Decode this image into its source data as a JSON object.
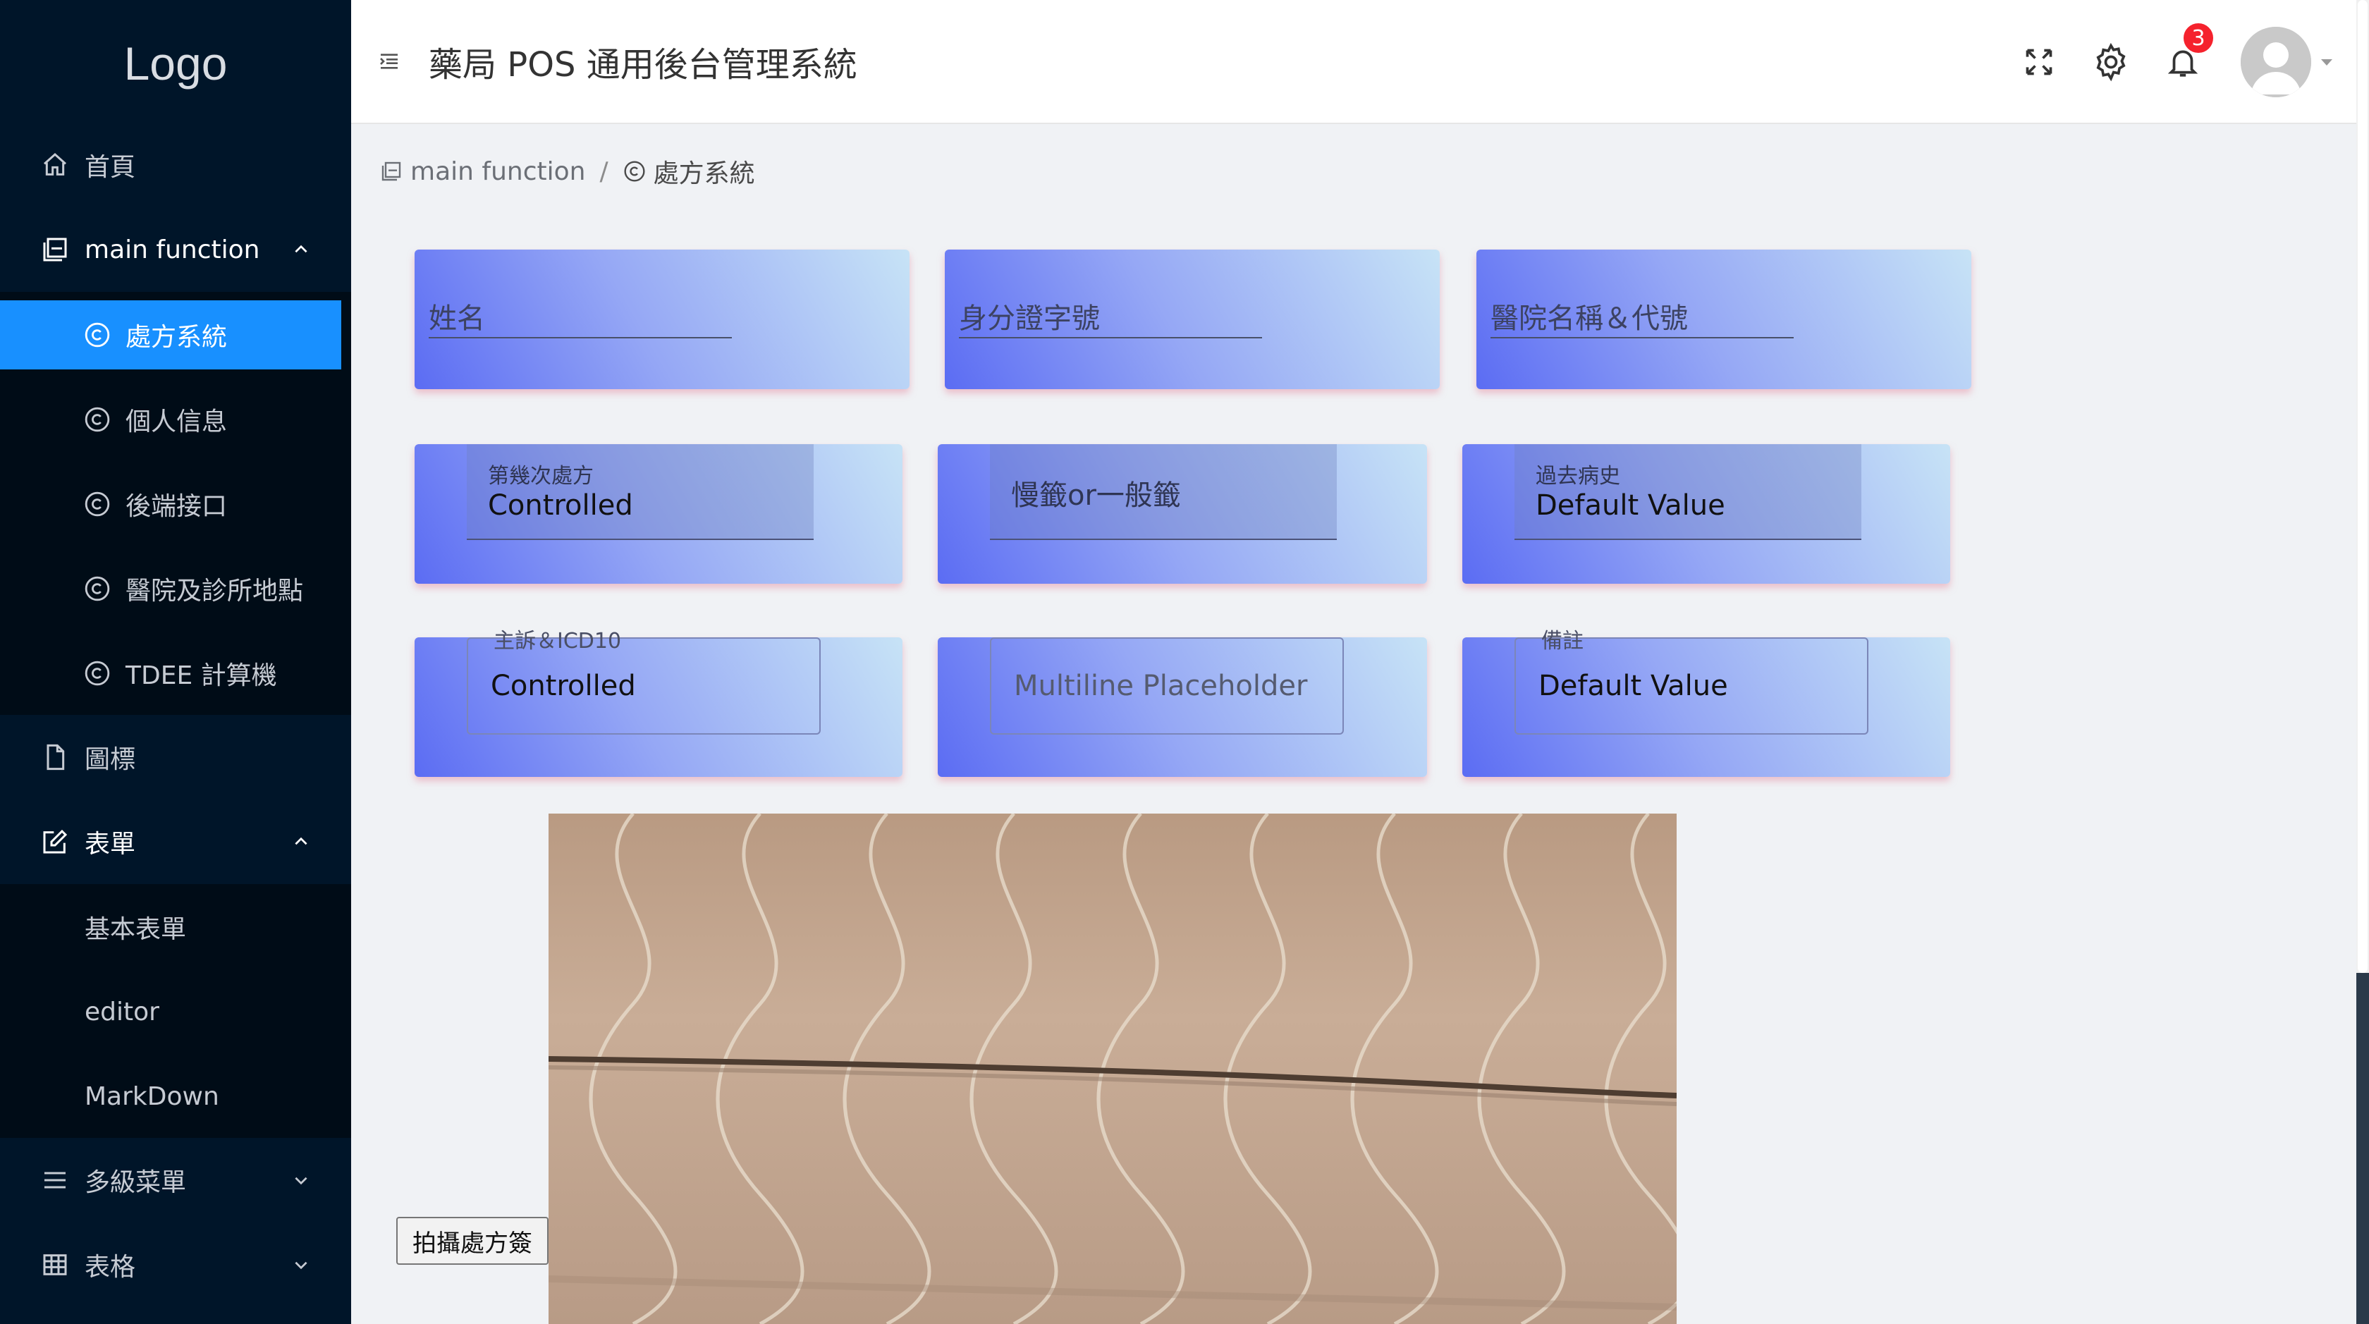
{
  "sidebar": {
    "logo": "Logo",
    "home": "首頁",
    "main_function": "main function",
    "main_sub": [
      "處方系統",
      "個人信息",
      "後端接口",
      "醫院及診所地點",
      "TDEE 計算機"
    ],
    "icons_label": "圖標",
    "forms": "表單",
    "forms_sub": [
      "基本表單",
      "editor",
      "MarkDown"
    ],
    "multi_menu": "多級菜單",
    "tables": "表格"
  },
  "header": {
    "title": "藥局 POS 通用後台管理系統",
    "notification_count": "3"
  },
  "breadcrumb": {
    "parent": "main function",
    "separator": "/",
    "current": "處方系統"
  },
  "form": {
    "row1": [
      "姓名",
      "身分證字號",
      "醫院名稱＆代號"
    ],
    "row2": [
      {
        "label": "第幾次處方",
        "value": "Controlled"
      },
      {
        "placeholder": "慢籤or一般籤"
      },
      {
        "label": "過去病史",
        "value": "Default Value"
      }
    ],
    "row3": [
      {
        "label": "主訴＆ICD10",
        "value": "Controlled"
      },
      {
        "placeholder": "Multiline Placeholder"
      },
      {
        "label": "備註",
        "value": "Default Value"
      }
    ]
  },
  "capture_button": "拍攝處方簽"
}
